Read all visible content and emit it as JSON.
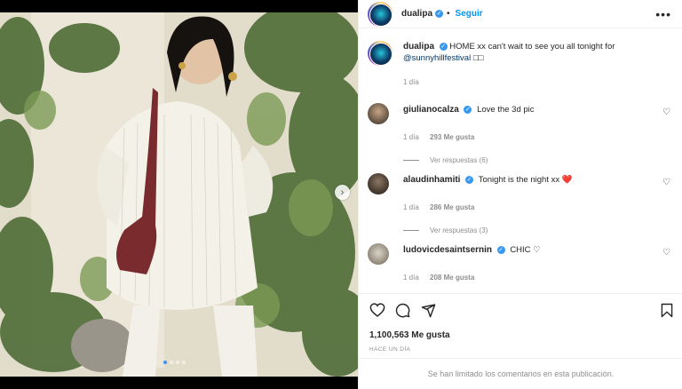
{
  "post": {
    "username": "dualipa",
    "follow_label": "Seguir",
    "separator": "•",
    "more_icon": "more-horizontal-icon",
    "carousel": {
      "total": 4,
      "active_index": 0
    }
  },
  "caption": {
    "username": "dualipa",
    "text": "HOME xx can't wait to see you all tonight for",
    "mention": "@sunnyhillfestival",
    "trailing": "□□",
    "time": "1 día"
  },
  "comments": [
    {
      "username": "giulianocalza",
      "text": "Love the 3d pic",
      "time": "1 día",
      "likes": "293 Me gusta",
      "replies": "Ver respuestas (6)"
    },
    {
      "username": "alaudinhamiti",
      "text": "Tonight is the night xx",
      "emoji": "❤️",
      "time": "1 día",
      "likes": "286 Me gusta",
      "replies": "Ver respuestas (3)"
    },
    {
      "username": "ludovicdesaintsernin",
      "text": "CHIC",
      "emoji": "♡",
      "time": "1 día",
      "likes": "208 Me gusta",
      "replies": ""
    }
  ],
  "stats": {
    "likes": "1,100,563 Me gusta",
    "date": "HACE UN DÍA"
  },
  "footer": {
    "limited": "Se han limitado los comentarios en esta publicación."
  },
  "colors": {
    "accent": "#0095f6",
    "verified": "#3897f0",
    "muted": "#8e8e8e"
  }
}
